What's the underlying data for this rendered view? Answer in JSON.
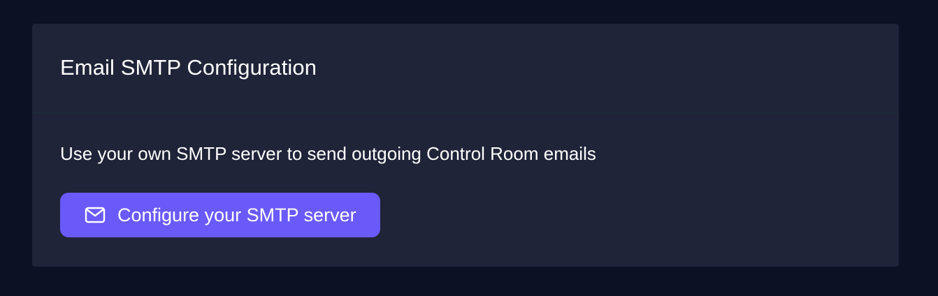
{
  "card": {
    "title": "Email SMTP Configuration",
    "description": "Use your own SMTP server to send outgoing Control Room emails",
    "configure_button": {
      "label": "Configure your SMTP server",
      "icon": "mail-icon"
    }
  },
  "colors": {
    "page_background": "#0c1124",
    "card_background": "#1f2438",
    "divider": "#1c2a36",
    "button_accent": "#6a5af9",
    "text": "#ffffff"
  }
}
